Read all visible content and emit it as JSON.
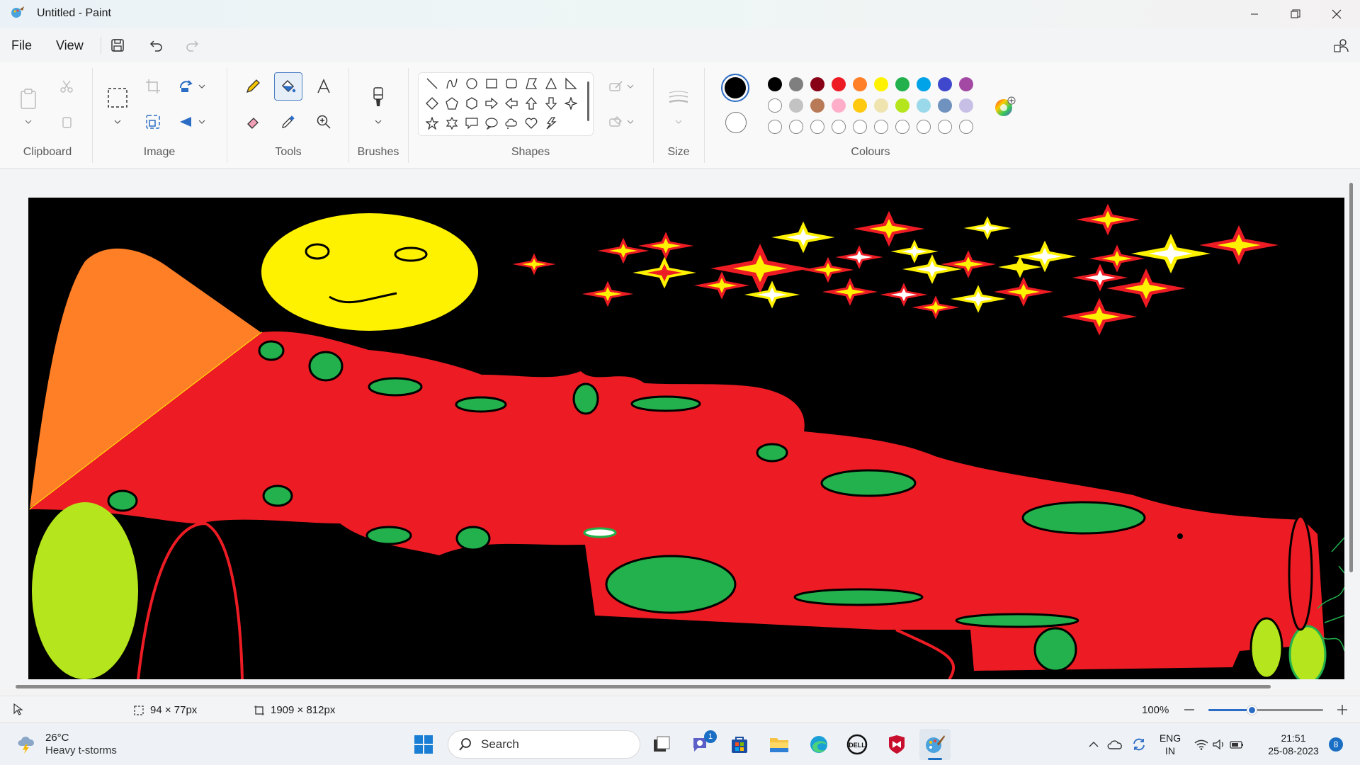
{
  "window": {
    "title": "Untitled - Paint"
  },
  "menu": {
    "file": "File",
    "view": "View"
  },
  "ribbon": {
    "groups": {
      "clipboard": "Clipboard",
      "image": "Image",
      "tools": "Tools",
      "brushes": "Brushes",
      "shapes": "Shapes",
      "size": "Size",
      "colours": "Colours"
    },
    "selected_tool": "fill-tool",
    "primary_color": "#000000",
    "secondary_color": "#ffffff",
    "palette_row1": [
      "#000000",
      "#7f7f7f",
      "#880015",
      "#ed1c24",
      "#ff7f27",
      "#fff200",
      "#22b14c",
      "#00a2e8",
      "#3f48cc",
      "#a349a4"
    ],
    "palette_row2": [
      "#ffffff",
      "#c3c3c3",
      "#b97a57",
      "#ffaec9",
      "#ffc90e",
      "#efe4b0",
      "#b5e61d",
      "#99d9ea",
      "#7092be",
      "#c8bfe7"
    ]
  },
  "status": {
    "selection_size": "94 × 77px",
    "canvas_size": "1909 × 812px",
    "zoom": "100%"
  },
  "taskbar": {
    "weather_temp": "26°C",
    "weather_desc": "Heavy t-storms",
    "search_placeholder": "Search",
    "teams_badge": "1",
    "lang_top": "ENG",
    "lang_bottom": "IN",
    "time": "21:51",
    "date": "25-08-2023",
    "notification_count": "8"
  }
}
